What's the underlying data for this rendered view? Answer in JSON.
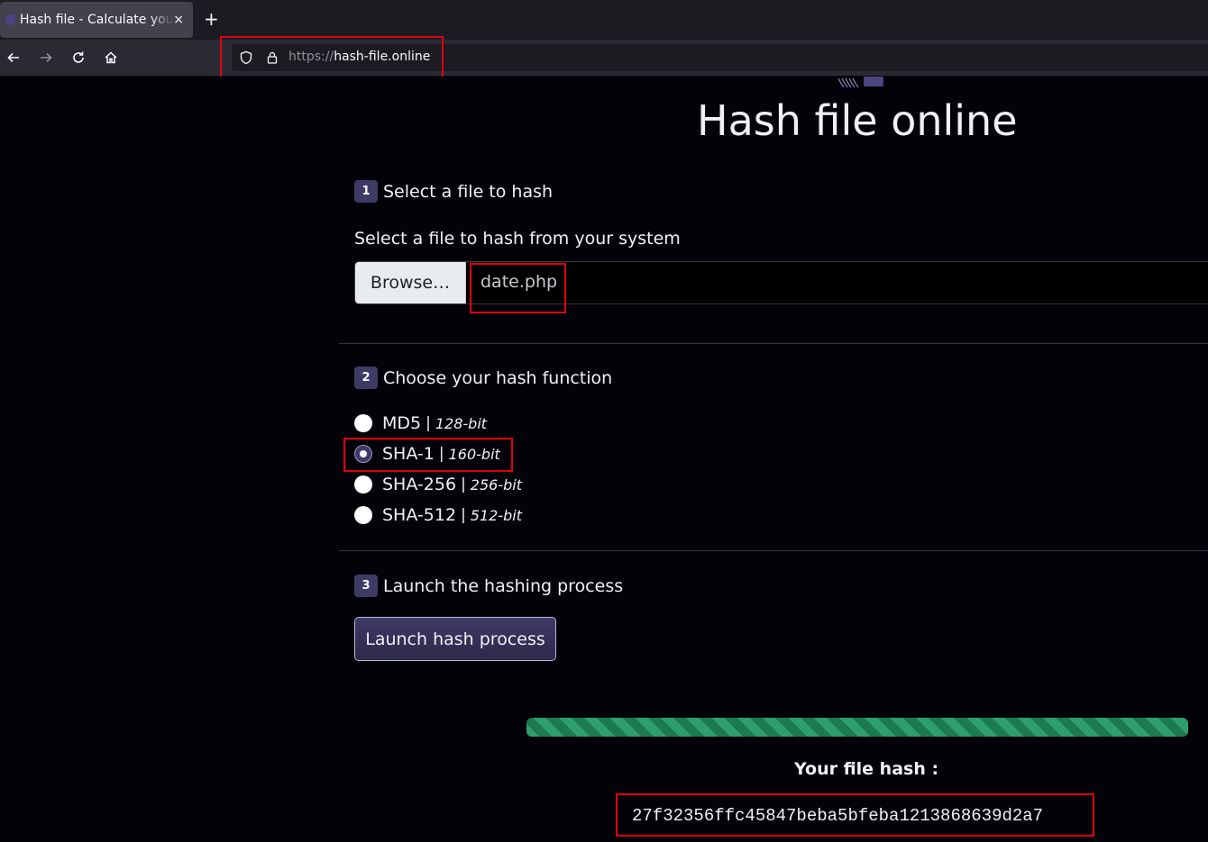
{
  "browser": {
    "tab_title": "Hash file - Calculate your file hash",
    "tab_close": "×",
    "new_tab": "+",
    "url_scheme": "https://",
    "url_host": "hash-file.online"
  },
  "page": {
    "title": "Hash file online",
    "step1": {
      "number": "1",
      "label": "Select a file to hash"
    },
    "file_prompt": "Select a file to hash from your system",
    "browse_label": "Browse…",
    "file_name": "date.php",
    "step2": {
      "number": "2",
      "label": "Choose your hash function"
    },
    "hash_options": [
      {
        "name": "MD5",
        "sep": "|",
        "bits": "128-bit",
        "checked": false
      },
      {
        "name": "SHA-1",
        "sep": "|",
        "bits": "160-bit",
        "checked": true
      },
      {
        "name": "SHA-256",
        "sep": "|",
        "bits": "256-bit",
        "checked": false
      },
      {
        "name": "SHA-512",
        "sep": "|",
        "bits": "512-bit",
        "checked": false
      }
    ],
    "step3": {
      "number": "3",
      "label": "Launch the hashing process"
    },
    "launch_label": "Launch hash process",
    "progress": 1.0,
    "hash_label": "Your file hash :",
    "hash_value": "27f32356ffc45847beba5bfeba1213868639d2a7"
  },
  "colors": {
    "accent": "#3e3a66",
    "progress": "#2e9e6c",
    "highlight": "#e0000f"
  }
}
